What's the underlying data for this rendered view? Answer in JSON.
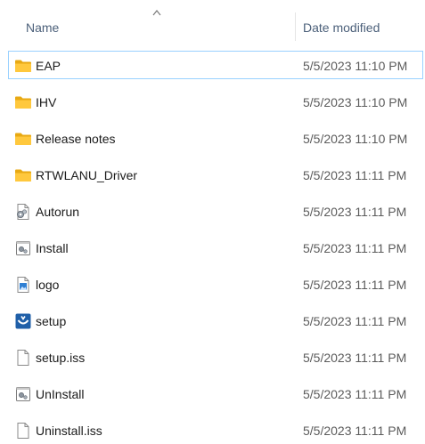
{
  "columns": {
    "name": "Name",
    "date_modified": "Date modified"
  },
  "sort": {
    "column": "Name",
    "direction": "ascending"
  },
  "files": [
    {
      "name": "EAP",
      "date": "5/5/2023 11:10 PM",
      "icon": "folder-icon"
    },
    {
      "name": "IHV",
      "date": "5/5/2023 11:10 PM",
      "icon": "folder-icon"
    },
    {
      "name": "Release notes",
      "date": "5/5/2023 11:10 PM",
      "icon": "folder-icon"
    },
    {
      "name": "RTWLANU_Driver",
      "date": "5/5/2023 11:11 PM",
      "icon": "folder-icon"
    },
    {
      "name": "Autorun",
      "date": "5/5/2023 11:11 PM",
      "icon": "settings-file-icon"
    },
    {
      "name": "Install",
      "date": "5/5/2023 11:11 PM",
      "icon": "batch-file-icon"
    },
    {
      "name": "logo",
      "date": "5/5/2023 11:11 PM",
      "icon": "image-file-icon"
    },
    {
      "name": "setup",
      "date": "5/5/2023 11:11 PM",
      "icon": "installer-app-icon"
    },
    {
      "name": "setup.iss",
      "date": "5/5/2023 11:11 PM",
      "icon": "blank-file-icon"
    },
    {
      "name": "UnInstall",
      "date": "5/5/2023 11:11 PM",
      "icon": "batch-file-icon"
    },
    {
      "name": "Uninstall.iss",
      "date": "5/5/2023 11:11 PM",
      "icon": "blank-file-icon"
    }
  ],
  "colors": {
    "folder": "#FFC83D",
    "folder_dark": "#E8A913",
    "header_text": "#4C607A",
    "focus_border": "#99D1FF",
    "setup_blue": "#1F5FA8"
  }
}
